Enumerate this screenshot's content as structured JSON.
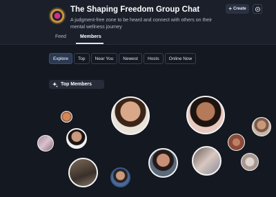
{
  "group": {
    "title": "The Shaping Freedom Group Chat",
    "description": "A judgment-free zone to be heard and connect with others on their mental wellness journey",
    "logo_icon": "group-logo"
  },
  "header_actions": {
    "create_label": "Create",
    "create_icon": "plus-icon",
    "settings_icon": "gear-icon"
  },
  "tabs": [
    {
      "label": "Feed",
      "active": false
    },
    {
      "label": "Members",
      "active": true
    }
  ],
  "filters": [
    {
      "label": "Explore",
      "active": true
    },
    {
      "label": "Top",
      "active": false
    },
    {
      "label": "Near You",
      "active": false
    },
    {
      "label": "Newest",
      "active": false
    },
    {
      "label": "Hosts",
      "active": false
    },
    {
      "label": "Online Now",
      "active": false
    }
  ],
  "section": {
    "label": "Top Members",
    "icon": "sparkle-icon"
  },
  "colors": {
    "background": "#141821",
    "header": "#1a1f2a",
    "active_filter": "#2b3a52"
  }
}
